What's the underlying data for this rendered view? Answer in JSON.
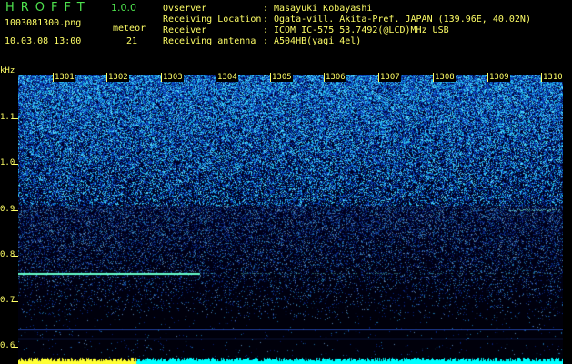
{
  "app": {
    "title": "HROFFT",
    "version": "1.0.0"
  },
  "file": {
    "name": "1003081300.png",
    "datetime": "10.03.08 13:00"
  },
  "meteor": {
    "label": "meteor",
    "count": "21"
  },
  "meta": [
    {
      "key": "Ovserver",
      "value": "Masayuki Kobayashi"
    },
    {
      "key": "Receiving Location",
      "value": "Ogata-vill. Akita-Pref. JAPAN (139.96E, 40.02N)"
    },
    {
      "key": "Receiver",
      "value": "ICOM IC-575 53.7492(@LCD)MHz USB"
    },
    {
      "key": "Receiving antenna",
      "value": "A504HB(yagi 4el)"
    }
  ],
  "freq_axis": {
    "unit": "kHz",
    "labels": [
      "1.1",
      "1.0",
      "0.9",
      "0.8",
      "0.7",
      "0.6"
    ]
  },
  "time_axis": {
    "labels": [
      "1301",
      "1302",
      "1303",
      "1304",
      "1305",
      "1306",
      "1307",
      "1308",
      "1309",
      "1310"
    ]
  },
  "colors": {
    "text": "#ffff66",
    "title": "#4ee24e",
    "trace": "#00ffff",
    "signal_line": "#66ffcc"
  }
}
